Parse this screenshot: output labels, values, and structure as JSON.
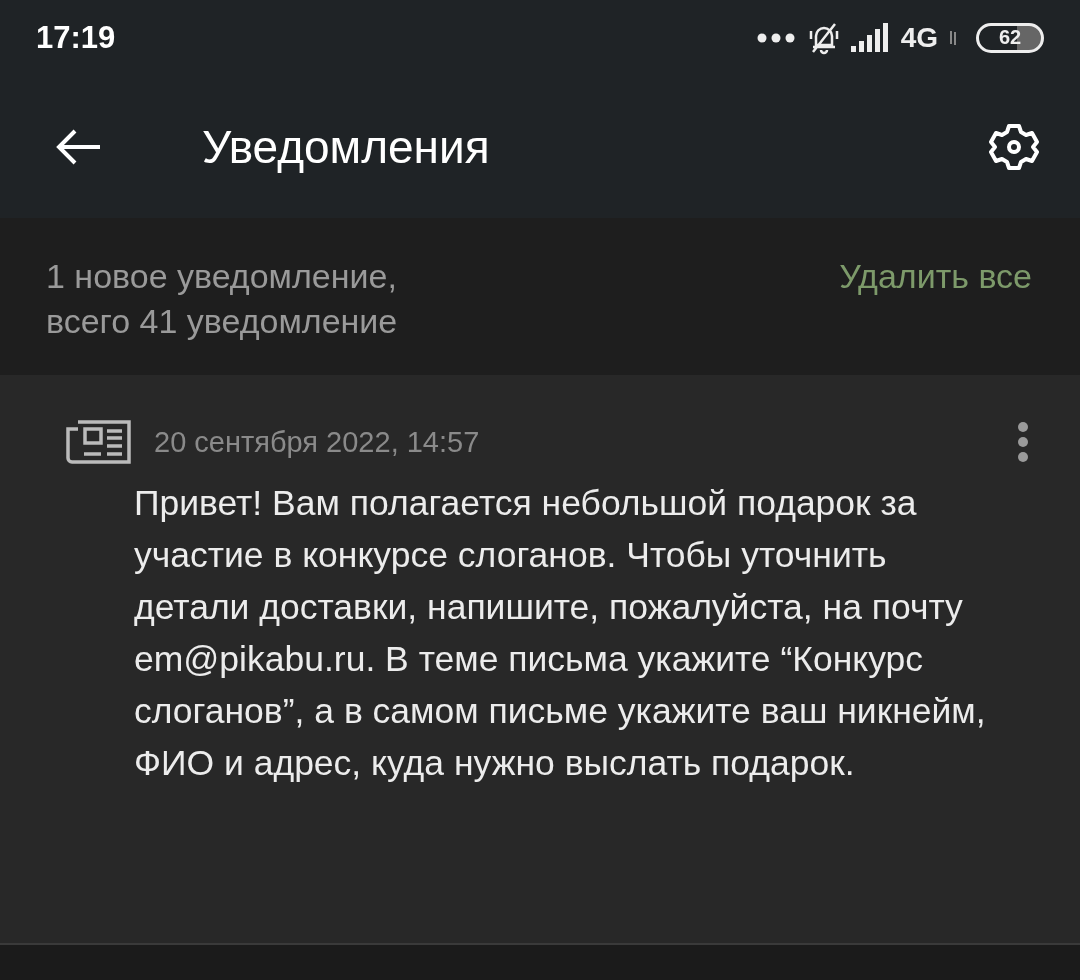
{
  "status_bar": {
    "time": "17:19",
    "network": "4G",
    "battery": "62"
  },
  "app_bar": {
    "title": "Уведомления"
  },
  "summary": {
    "text": "1 новое уведомление,\nвсего 41 уведомление",
    "action": "Удалить все"
  },
  "notifications": [
    {
      "date": "20 сентября 2022, 14:57",
      "message": "Привет! Вам полагается небольшой подарок за участие в конкурсе слоганов. Чтобы уточнить детали доставки, напишите, пожалуйста, на почту em@pikabu.ru. В теме письма укажите “Конкурс слоганов”, а в самом письме укажите ваш никнейм, ФИО и адрес, куда нужно выслать подарок."
    }
  ]
}
